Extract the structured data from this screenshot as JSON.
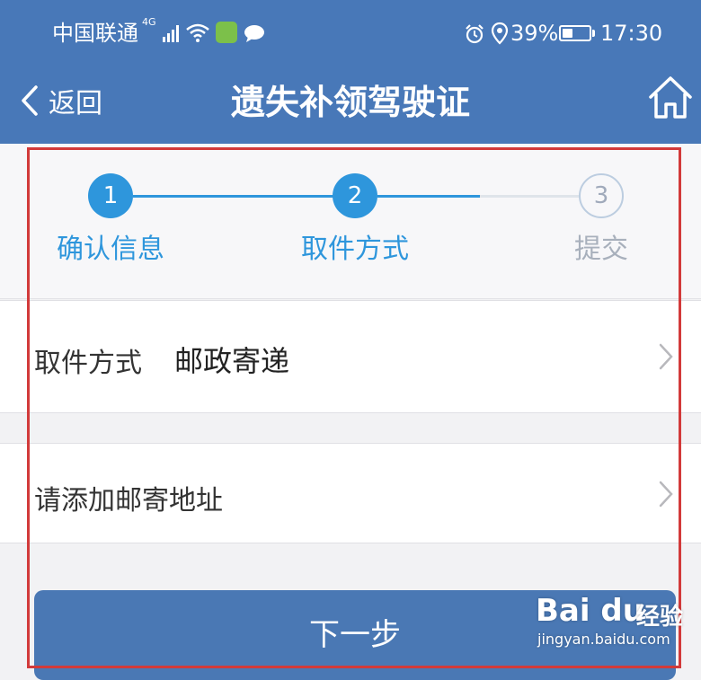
{
  "status_bar": {
    "carrier": "中国联通",
    "network": "4G",
    "battery": "39%",
    "battery_level": 0.39,
    "time": "17:30"
  },
  "nav": {
    "back_label": "返回",
    "title": "遗失补领驾驶证",
    "home_icon": "home-icon"
  },
  "steps": [
    {
      "number": "1",
      "label": "确认信息",
      "state": "done"
    },
    {
      "number": "2",
      "label": "取件方式",
      "state": "current"
    },
    {
      "number": "3",
      "label": "提交",
      "state": "pending"
    }
  ],
  "pickup": {
    "label": "取件方式",
    "value": "邮政寄递"
  },
  "address": {
    "label": "请添加邮寄地址"
  },
  "next_button": "下一步",
  "watermark": {
    "brand": "Bai du",
    "text": "经验",
    "url": "jingyan.baidu.com"
  },
  "colors": {
    "header": "#4878b8",
    "step_active": "#2e96dc",
    "highlight_frame": "#d23a3a",
    "button": "#4a78b4"
  }
}
